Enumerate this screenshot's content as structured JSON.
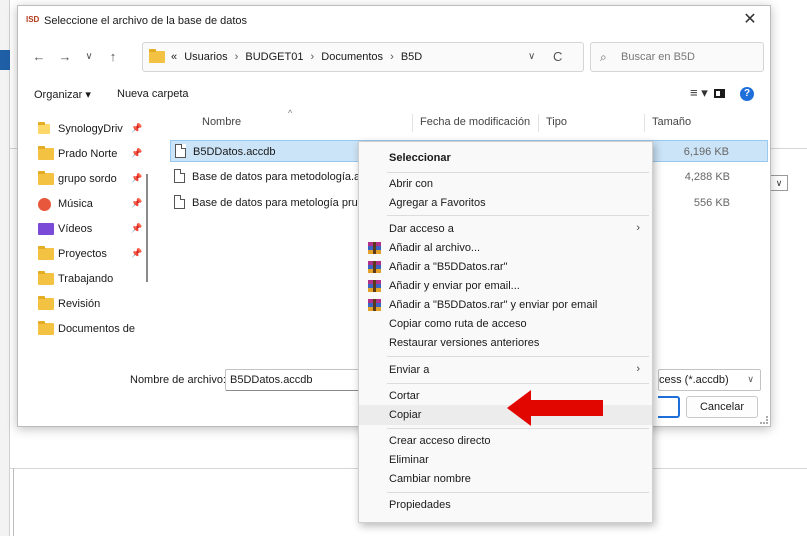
{
  "dialog": {
    "app_icon_text": "ISD",
    "title": "Seleccione el archivo de la base de datos",
    "close_glyph": "✕"
  },
  "nav": {
    "back_glyph": "←",
    "forward_glyph": "→",
    "history_glyph": "∨",
    "up_glyph": "↑",
    "breadcrumb_prefix": "«",
    "breadcrumbs": [
      "Usuarios",
      "BUDGET01",
      "Documentos",
      "B5D"
    ],
    "crumb_separator": "›",
    "address_dropdown_glyph": "∨",
    "refresh_glyph": "C",
    "search_placeholder": "Buscar en B5D"
  },
  "toolbar": {
    "organize_label": "Organizar ▾",
    "new_folder_label": "Nueva carpeta",
    "view_glyph": "≡ ▾",
    "help_glyph": "?"
  },
  "sidebar": {
    "pin_glyph": "📌",
    "items": [
      {
        "label": "SynologyDriv",
        "icon": "synology-folder-icon",
        "pinned": true
      },
      {
        "label": "Prado Norte",
        "icon": "folder-icon",
        "pinned": true
      },
      {
        "label": "grupo sordo",
        "icon": "folder-icon",
        "pinned": true
      },
      {
        "label": "Música",
        "icon": "music-icon",
        "pinned": true
      },
      {
        "label": "Vídeos",
        "icon": "video-icon",
        "pinned": true
      },
      {
        "label": "Proyectos",
        "icon": "folder-icon",
        "pinned": true
      },
      {
        "label": "Trabajando",
        "icon": "folder-icon",
        "pinned": false
      },
      {
        "label": "Revisión",
        "icon": "folder-icon",
        "pinned": false
      },
      {
        "label": "Documentos de",
        "icon": "folder-icon",
        "pinned": false
      }
    ]
  },
  "files": {
    "sort_glyph": "^",
    "columns": [
      "Nombre",
      "Fecha de modificación",
      "Tipo",
      "Tamaño"
    ],
    "rows": [
      {
        "name": "B5DDatos.accdb",
        "size": "6,196 KB",
        "selected": true
      },
      {
        "name": "Base de datos para metodología.acc",
        "size": "4,288 KB",
        "selected": false
      },
      {
        "name": "Base de datos para metología prueb",
        "size": "556 KB",
        "selected": false
      }
    ]
  },
  "footer": {
    "filename_label": "Nombre de archivo:",
    "filename_value": "B5DDatos.accdb",
    "filter_value": "cess (*.accdb)",
    "filter_dropdown_glyph": "∨",
    "cancel_label": "Cancelar"
  },
  "context_menu": {
    "submenu_glyph": "›",
    "items": [
      {
        "label": "Seleccionar",
        "bold": true
      },
      {
        "label": "Abrir con"
      },
      {
        "label": "Agregar a Favoritos"
      },
      {
        "label": "Dar acceso a",
        "submenu": true
      },
      {
        "label": "Añadir al archivo...",
        "icon": "winrar-icon"
      },
      {
        "label": "Añadir a \"B5DDatos.rar\"",
        "icon": "winrar-icon"
      },
      {
        "label": "Añadir y enviar por email...",
        "icon": "winrar-icon"
      },
      {
        "label": "Añadir a \"B5DDatos.rar\" y enviar por email",
        "icon": "winrar-icon"
      },
      {
        "label": "Copiar como ruta de acceso"
      },
      {
        "label": "Restaurar versiones anteriores"
      },
      {
        "label": "Enviar a",
        "submenu": true
      },
      {
        "label": "Cortar"
      },
      {
        "label": "Copiar",
        "hover": true
      },
      {
        "label": "Crear acceso directo"
      },
      {
        "label": "Eliminar"
      },
      {
        "label": "Cambiar nombre"
      },
      {
        "label": "Propiedades"
      }
    ]
  },
  "background": {
    "combo_glyph": "∨"
  },
  "colors": {
    "accent": "#1e6fd9",
    "selection": "#cce4f7",
    "arrow": "#e10600",
    "folder": "#f4c242"
  }
}
